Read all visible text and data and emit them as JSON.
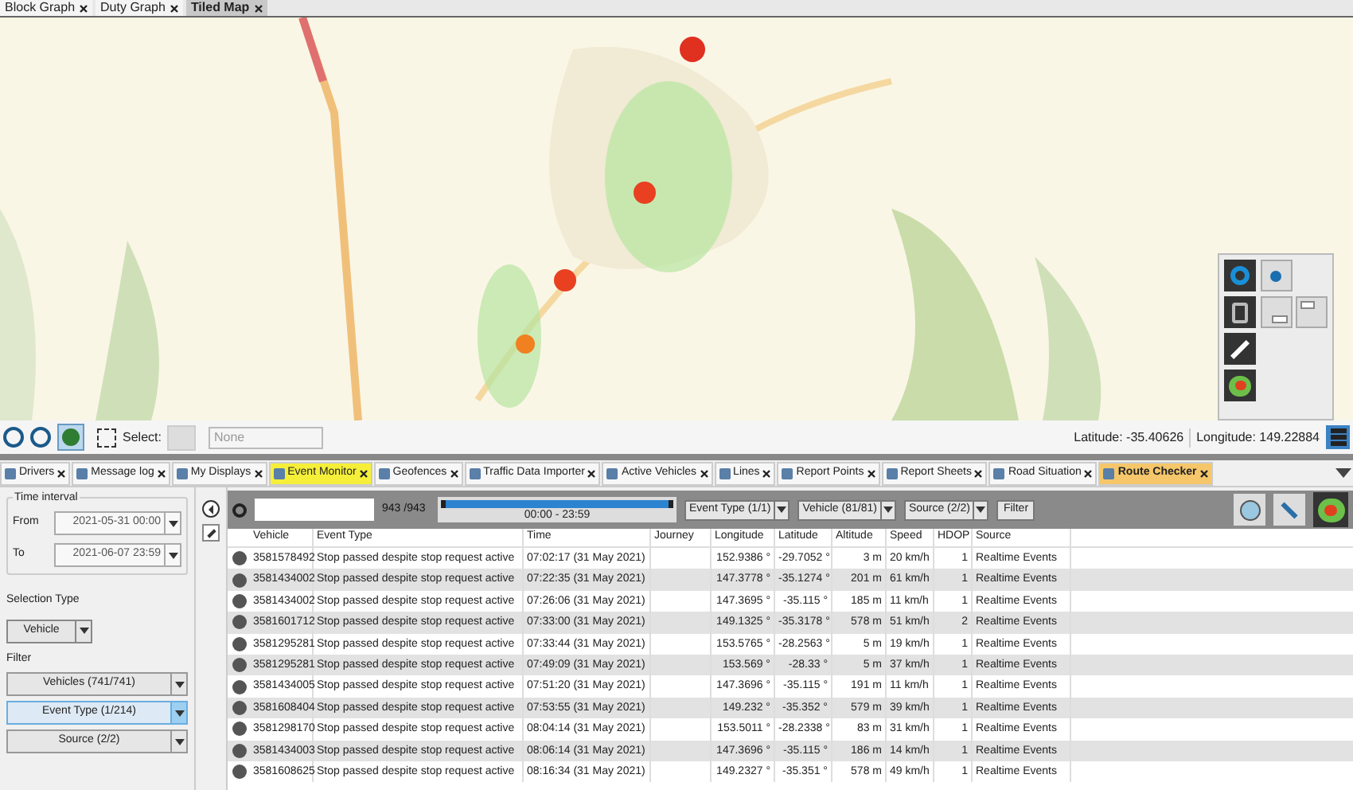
{
  "top_tabs": [
    {
      "label": "Block Graph",
      "selected": false
    },
    {
      "label": "Duty Graph",
      "selected": false
    },
    {
      "label": "Tiled Map",
      "selected": true
    }
  ],
  "map_toolbar": {
    "select_label": "Select:",
    "select_value": "None",
    "latitude_label": "Latitude:",
    "latitude": "-35.40626",
    "longitude_label": "Longitude:",
    "longitude": "149.22884"
  },
  "panel_tabs": [
    {
      "label": "Drivers",
      "selected": false,
      "highlighted": false
    },
    {
      "label": "Message log",
      "selected": false,
      "highlighted": false
    },
    {
      "label": "My Displays",
      "selected": false,
      "highlighted": false
    },
    {
      "label": "Event Monitor",
      "selected": false,
      "highlighted": true
    },
    {
      "label": "Geofences",
      "selected": false,
      "highlighted": false
    },
    {
      "label": "Traffic Data Importer",
      "selected": false,
      "highlighted": false
    },
    {
      "label": "Active Vehicles",
      "selected": false,
      "highlighted": false
    },
    {
      "label": "Lines",
      "selected": false,
      "highlighted": false
    },
    {
      "label": "Report Points",
      "selected": false,
      "highlighted": false
    },
    {
      "label": "Report Sheets",
      "selected": false,
      "highlighted": false
    },
    {
      "label": "Road Situation",
      "selected": false,
      "highlighted": false
    },
    {
      "label": "Route Checker",
      "selected": true,
      "highlighted": false
    }
  ],
  "time_interval": {
    "title": "Time interval",
    "from_label": "From",
    "from": "2021-05-31 00:00",
    "to_label": "To",
    "to": "2021-06-07 23:59"
  },
  "selection_type": {
    "label": "Selection Type",
    "value": "Vehicle"
  },
  "filter": {
    "label": "Filter",
    "buttons": [
      {
        "label": "Vehicles (741/741)",
        "selected": false
      },
      {
        "label": "Event Type (1/214)",
        "selected": true
      },
      {
        "label": "Source (2/2)",
        "selected": false
      }
    ]
  },
  "table_toolbar": {
    "count": "943 /943",
    "time_range": "00:00 - 23:59",
    "time_range_slider": {
      "level": 1
    },
    "dropdowns": [
      "Event Type (1/1)",
      "Vehicle (81/81)",
      "Source (2/2)"
    ],
    "filter_button": "Filter"
  },
  "table": {
    "columns": [
      "Vehicle",
      "Event Type",
      "Time",
      "Journey",
      "Longitude",
      "Latitude",
      "Altitude",
      "Speed",
      "HDOP",
      "Source"
    ],
    "rows": [
      [
        "3581578492",
        "Stop passed despite stop request active",
        "07:02:17 (31 May 2021)",
        "",
        "152.9386 °",
        "-29.7052 °",
        "3 m",
        "20 km/h",
        "1",
        "Realtime Events"
      ],
      [
        "3581434002",
        "Stop passed despite stop request active",
        "07:22:35 (31 May 2021)",
        "",
        "147.3778 °",
        "-35.1274 °",
        "201 m",
        "61 km/h",
        "1",
        "Realtime Events"
      ],
      [
        "3581434002",
        "Stop passed despite stop request active",
        "07:26:06 (31 May 2021)",
        "",
        "147.3695 °",
        "-35.115 °",
        "185 m",
        "11 km/h",
        "1",
        "Realtime Events"
      ],
      [
        "3581601712",
        "Stop passed despite stop request active",
        "07:33:00 (31 May 2021)",
        "",
        "149.1325 °",
        "-35.3178 °",
        "578 m",
        "51 km/h",
        "2",
        "Realtime Events"
      ],
      [
        "3581295281",
        "Stop passed despite stop request active",
        "07:33:44 (31 May 2021)",
        "",
        "153.5765 °",
        "-28.2563 °",
        "5 m",
        "19 km/h",
        "1",
        "Realtime Events"
      ],
      [
        "3581295281",
        "Stop passed despite stop request active",
        "07:49:09 (31 May 2021)",
        "",
        "153.569 °",
        "-28.33 °",
        "5 m",
        "37 km/h",
        "1",
        "Realtime Events"
      ],
      [
        "3581434005",
        "Stop passed despite stop request active",
        "07:51:20 (31 May 2021)",
        "",
        "147.3696 °",
        "-35.115 °",
        "191 m",
        "11 km/h",
        "1",
        "Realtime Events"
      ],
      [
        "3581608404",
        "Stop passed despite stop request active",
        "07:53:55 (31 May 2021)",
        "",
        "149.232 °",
        "-35.352 °",
        "579 m",
        "39 km/h",
        "1",
        "Realtime Events"
      ],
      [
        "3581298170",
        "Stop passed despite stop request active",
        "08:04:14 (31 May 2021)",
        "",
        "153.5011 °",
        "-28.2338 °",
        "83 m",
        "31 km/h",
        "1",
        "Realtime Events"
      ],
      [
        "3581434003",
        "Stop passed despite stop request active",
        "08:06:14 (31 May 2021)",
        "",
        "147.3696 °",
        "-35.115 °",
        "186 m",
        "14 km/h",
        "1",
        "Realtime Events"
      ],
      [
        "3581608625",
        "Stop passed despite stop request active",
        "08:16:34 (31 May 2021)",
        "",
        "149.2327 °",
        "-35.351 °",
        "578 m",
        "49 km/h",
        "1",
        "Realtime Events"
      ]
    ]
  }
}
